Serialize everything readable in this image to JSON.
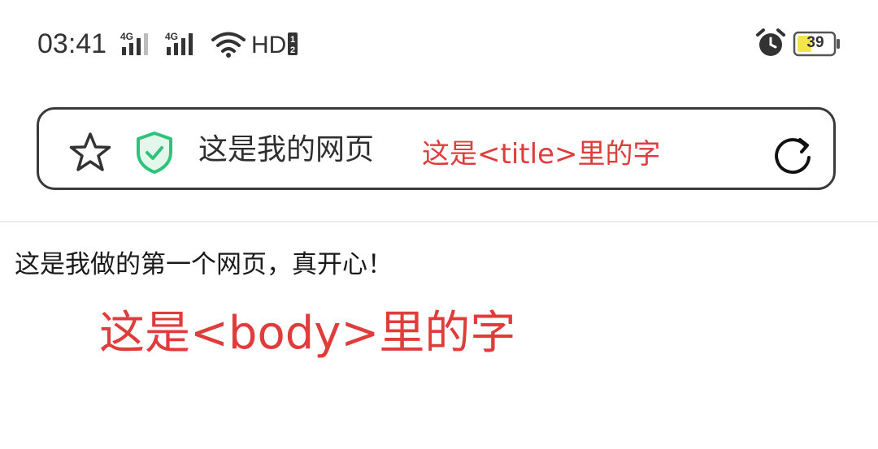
{
  "status_bar": {
    "time": "03:41",
    "battery": "39",
    "icons": [
      "signal-4g-icon",
      "signal-4g-icon",
      "wifi-icon",
      "hd-icon",
      "alarm-icon",
      "battery-icon"
    ]
  },
  "address_bar": {
    "page_title": "这是我的网页",
    "annotation": "这是<title>里的字",
    "icons": [
      "star-icon",
      "shield-check-icon",
      "refresh-icon"
    ]
  },
  "content": {
    "body_text": "这是我做的第一个网页，真开心！",
    "annotation": "这是<body>里的字"
  },
  "colors": {
    "annotation": "#e03c3c",
    "shield": "#2fc27a",
    "battery_fill": "#f2e64a"
  }
}
